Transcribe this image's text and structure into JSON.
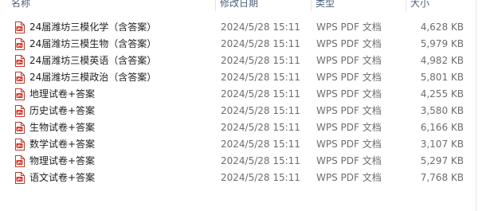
{
  "columns": {
    "name": "名称",
    "date": "修改日期",
    "type": "类型",
    "size": "大小"
  },
  "files": [
    {
      "name": "24届潍坊三模化学（含答案）",
      "date": "2024/5/28 15:11",
      "type": "WPS PDF 文档",
      "size": "4,628 KB",
      "icon": "pdf-file-icon"
    },
    {
      "name": "24届潍坊三模生物（含答案）",
      "date": "2024/5/28 15:11",
      "type": "WPS PDF 文档",
      "size": "5,979 KB",
      "icon": "pdf-file-icon"
    },
    {
      "name": "24届潍坊三模英语（含答案）",
      "date": "2024/5/28 15:11",
      "type": "WPS PDF 文档",
      "size": "4,982 KB",
      "icon": "pdf-file-icon"
    },
    {
      "name": "24届潍坊三模政治（含答案）",
      "date": "2024/5/28 15:11",
      "type": "WPS PDF 文档",
      "size": "5,801 KB",
      "icon": "pdf-file-icon"
    },
    {
      "name": "地理试卷+答案",
      "date": "2024/5/28 15:11",
      "type": "WPS PDF 文档",
      "size": "4,255 KB",
      "icon": "pdf-file-icon"
    },
    {
      "name": "历史试卷+答案",
      "date": "2024/5/28 15:11",
      "type": "WPS PDF 文档",
      "size": "3,580 KB",
      "icon": "pdf-file-icon"
    },
    {
      "name": "生物试卷+答案",
      "date": "2024/5/28 15:11",
      "type": "WPS PDF 文档",
      "size": "6,166 KB",
      "icon": "pdf-file-icon"
    },
    {
      "name": "数学试卷+答案",
      "date": "2024/5/28 15:11",
      "type": "WPS PDF 文档",
      "size": "3,107 KB",
      "icon": "pdf-file-icon"
    },
    {
      "name": "物理试卷+答案",
      "date": "2024/5/28 15:11",
      "type": "WPS PDF 文档",
      "size": "5,297 KB",
      "icon": "pdf-file-icon"
    },
    {
      "name": "语文试卷+答案",
      "date": "2024/5/28 15:11",
      "type": "WPS PDF 文档",
      "size": "7,768 KB",
      "icon": "pdf-file-icon"
    }
  ],
  "colors": {
    "pdf_icon": "#d83b2f",
    "header_text": "#4c607a",
    "detail_text": "#6d6d6d"
  }
}
